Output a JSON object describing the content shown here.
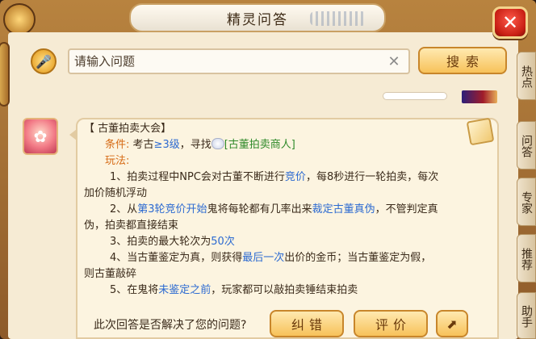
{
  "window": {
    "title": "精灵问答",
    "close_label": "✕"
  },
  "search": {
    "placeholder": "请输入问题",
    "value": "",
    "clear_label": "✕",
    "button_label": "搜索"
  },
  "side_tabs": [
    {
      "label": "热点"
    },
    {
      "label": "问答"
    },
    {
      "label": "专家"
    },
    {
      "label": "推荐"
    },
    {
      "label": "助手"
    }
  ],
  "answer": {
    "heading": "【 古董拍卖大会】",
    "condition_label": "条件:",
    "condition_text_a": "考古",
    "condition_level": "≥3级",
    "condition_text_b": "，寻找",
    "condition_npc": "[古董拍卖商人]",
    "gameplay_label": "玩法:",
    "rule1_a": "1、拍卖过程中NPC会对古董不断进行",
    "rule1_hl": "竞价",
    "rule1_b": "，每8秒进行一轮拍卖，每次",
    "rule1_c": "加价随机浮动",
    "rule2_a": "2、从",
    "rule2_hl1": "第3轮竞价开始",
    "rule2_b": "鬼将每轮都有几率出来",
    "rule2_hl2": "裁定古董真",
    "rule2_c": "伪",
    "rule2_d": "，不管判定真",
    "rule2_e": "伪，拍卖都直接结束",
    "rule3_a": "3、拍卖的最大轮次为",
    "rule3_hl": "50次",
    "rule4_a": "4、当古董鉴定为真，则获得",
    "rule4_hl": "最后一次",
    "rule4_b": "出价的金币；当古董鉴定为假，",
    "rule4_c": "则古董敲碎",
    "rule5_a": "5、在鬼将",
    "rule5_hl": "未鉴定之前",
    "rule5_b": "，玩家都可以敲拍卖锤结束拍卖"
  },
  "feedback": {
    "question": "此次回答是否解决了您的问题?",
    "correct_label": "纠错",
    "rate_label": "评价"
  },
  "colors": {
    "accent_orange": "#d66a14",
    "link_blue": "#2c6ad1",
    "npc_green": "#2f8a2a",
    "button_gold": "#f7c25a",
    "close_red": "#c81f14"
  }
}
